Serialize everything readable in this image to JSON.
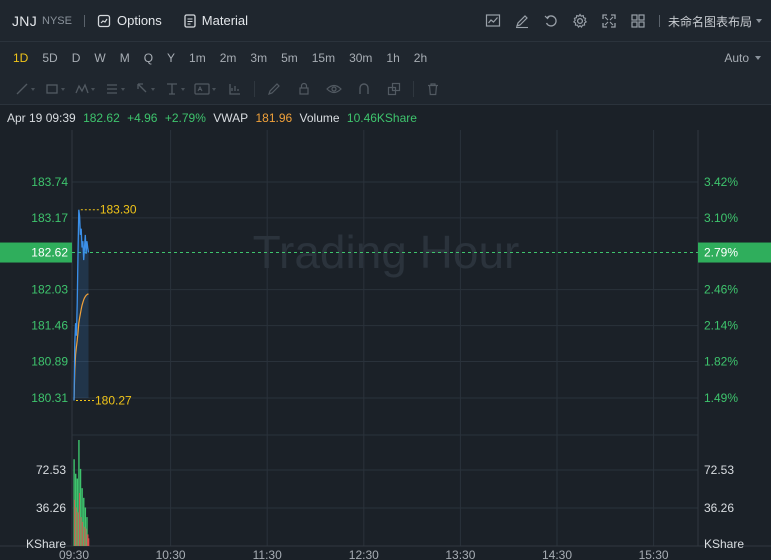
{
  "header": {
    "ticker": "JNJ",
    "exchange": "NYSE",
    "options_label": "Options",
    "material_label": "Material",
    "layout_name": "未命名图表布局",
    "right_icons": [
      "indicators-icon",
      "draw-icon",
      "replay-icon",
      "settings-icon",
      "fullscreen-icon",
      "layout-grid-icon"
    ]
  },
  "intervals": {
    "items": [
      "1D",
      "5D",
      "D",
      "W",
      "M",
      "Q",
      "Y",
      "1m",
      "2m",
      "3m",
      "5m",
      "15m",
      "30m",
      "1h",
      "2h"
    ],
    "active": "1D",
    "auto_label": "Auto"
  },
  "draw_tools": [
    "line-tool-icon",
    "rectangle-tool-icon",
    "pattern-tool-icon",
    "fib-tool-icon",
    "cursor-tool-icon",
    "measure-tool-icon",
    "text-tool-icon",
    "chart-tool-icon",
    "pen-tool-icon",
    "lock-icon",
    "eye-icon",
    "magnet-icon",
    "group-icon",
    "trash-icon"
  ],
  "info": {
    "date": "Apr 19 09:39",
    "price": "182.62",
    "change": "+4.96",
    "change_pct": "+2.79%",
    "vwap_label": "VWAP",
    "vwap_value": "181.96",
    "volume_label": "Volume",
    "volume_value": "10.46KShare"
  },
  "chart_data": {
    "type": "line",
    "watermark": "Trading Hour",
    "price_ticks": [
      "183.74",
      "183.17",
      "182.03",
      "181.46",
      "180.89",
      "180.31"
    ],
    "percent_ticks": [
      "3.42%",
      "3.10%",
      "2.46%",
      "2.14%",
      "1.82%",
      "1.49%"
    ],
    "current_price": "182.62",
    "current_pct": "2.79%",
    "high_label": "183.30",
    "low_label": "180.27",
    "volume_ticks": [
      "72.53",
      "36.26"
    ],
    "volume_unit": "KShare",
    "time_ticks": [
      "09:30",
      "10:30",
      "11:30",
      "12:30",
      "13:30",
      "14:30",
      "15:30"
    ],
    "price_min": 180.31,
    "price_max": 183.74,
    "price_series": {
      "name": "",
      "x": [
        0,
        0.5,
        1,
        1.5,
        2,
        2.5,
        3,
        3.5,
        4,
        4.5,
        5,
        5.5,
        6,
        6.5,
        7,
        7.5,
        8,
        8.5,
        9
      ],
      "y": [
        180.27,
        181.2,
        181.5,
        181.3,
        181.8,
        182.6,
        183.3,
        183.2,
        182.9,
        183.0,
        182.7,
        182.8,
        182.5,
        182.7,
        182.9,
        182.6,
        182.8,
        182.7,
        182.62
      ]
    },
    "vwap_series": {
      "name": "VWAP",
      "x": [
        0,
        0.5,
        1,
        1.5,
        2,
        2.5,
        3,
        3.5,
        4,
        4.5,
        5,
        5.5,
        6,
        6.5,
        7,
        7.5,
        8,
        8.5,
        9
      ],
      "y": [
        180.27,
        180.75,
        181.0,
        181.12,
        181.22,
        181.35,
        181.5,
        181.58,
        181.65,
        181.72,
        181.78,
        181.83,
        181.87,
        181.9,
        181.92,
        181.94,
        181.95,
        181.96,
        181.96
      ]
    },
    "volume_series": {
      "name": "Volume",
      "x": [
        0,
        0.5,
        1,
        1.5,
        2,
        2.5,
        3,
        3.5,
        4,
        4.5,
        5,
        5.5,
        6,
        6.5,
        7,
        7.5,
        8,
        8.5,
        9
      ],
      "y": [
        90,
        48,
        75,
        40,
        70,
        35,
        110,
        55,
        80,
        30,
        60,
        25,
        50,
        20,
        40,
        18,
        30,
        12,
        8
      ],
      "up": [
        true,
        false,
        true,
        false,
        true,
        false,
        true,
        false,
        true,
        false,
        true,
        false,
        true,
        false,
        true,
        false,
        true,
        false,
        false
      ]
    },
    "volume_max": 110,
    "colors": {
      "up": "#3ec46d",
      "down": "#e04c4c",
      "price_line": "#3b8fe8",
      "vwap_line": "#f0a13a",
      "accent": "#f0c419"
    }
  }
}
